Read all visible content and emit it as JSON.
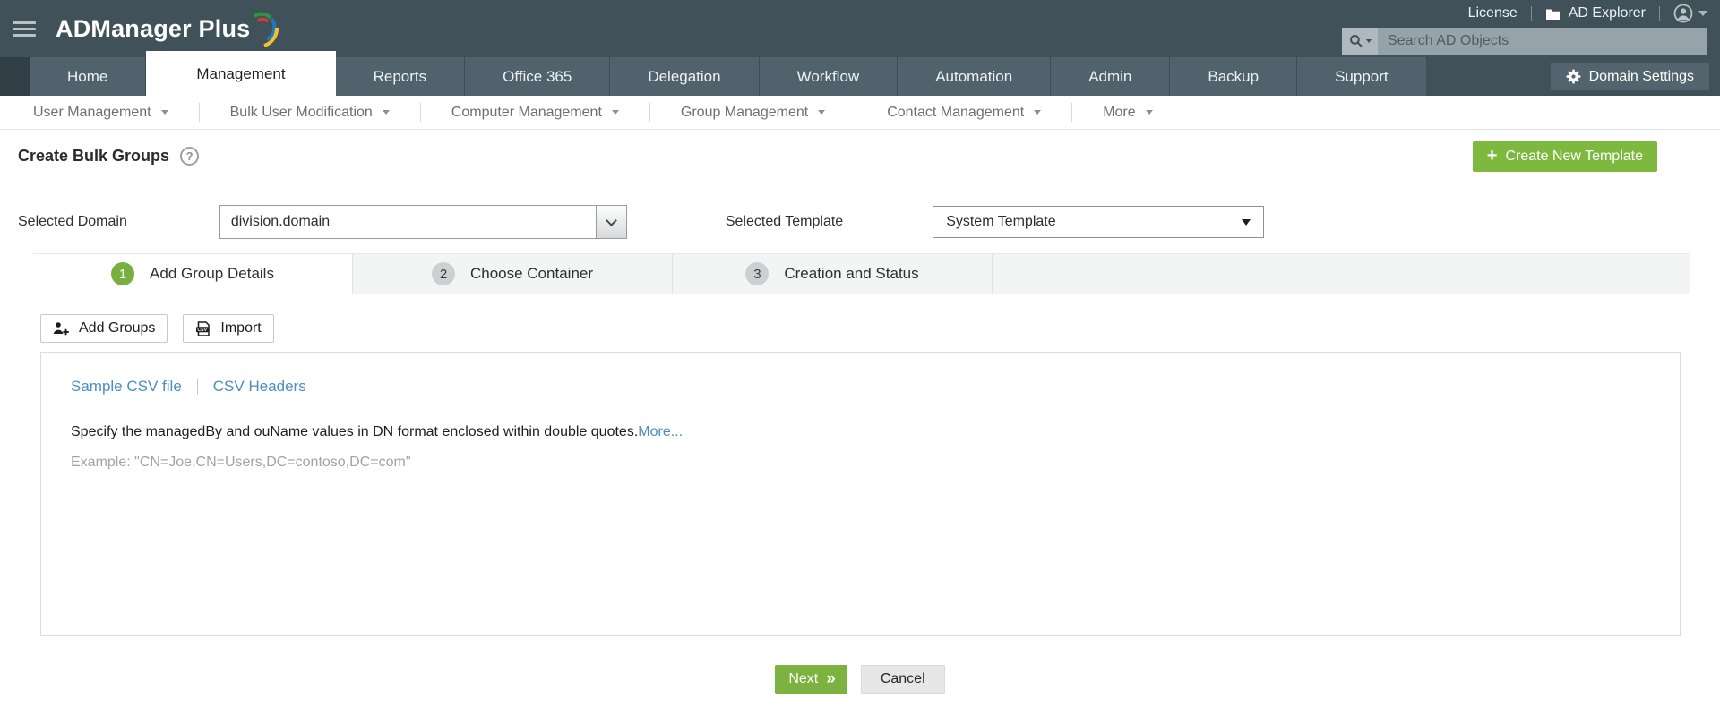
{
  "brand": {
    "logo_text": "ADManager Plus"
  },
  "topbar": {
    "license": "License",
    "ad_explorer": "AD Explorer",
    "search_placeholder": "Search AD Objects",
    "domain_settings": "Domain Settings"
  },
  "nav": {
    "tabs": [
      {
        "label": "Home"
      },
      {
        "label": "Management",
        "active": true
      },
      {
        "label": "Reports"
      },
      {
        "label": "Office 365"
      },
      {
        "label": "Delegation"
      },
      {
        "label": "Workflow"
      },
      {
        "label": "Automation"
      },
      {
        "label": "Admin"
      },
      {
        "label": "Backup"
      },
      {
        "label": "Support"
      }
    ]
  },
  "subnav": {
    "items": [
      {
        "label": "User Management"
      },
      {
        "label": "Bulk User Modification"
      },
      {
        "label": "Computer Management"
      },
      {
        "label": "Group Management"
      },
      {
        "label": "Contact Management"
      },
      {
        "label": "More"
      }
    ]
  },
  "page": {
    "title": "Create Bulk Groups",
    "help_glyph": "?",
    "create_template": "Create New Template",
    "plus_glyph": "+"
  },
  "form": {
    "domain_label": "Selected Domain",
    "domain_value": "division.domain",
    "template_label": "Selected Template",
    "template_value": "System Template"
  },
  "steps": [
    {
      "number": "1",
      "label": "Add Group Details",
      "active": true
    },
    {
      "number": "2",
      "label": "Choose Container"
    },
    {
      "number": "3",
      "label": "Creation and Status"
    }
  ],
  "toolbar": {
    "add_groups": "Add Groups",
    "import": "Import"
  },
  "content": {
    "sample_csv": "Sample CSV file",
    "csv_headers": "CSV Headers",
    "instruction": "Specify the managedBy and ouName values in DN format enclosed within double quotes.",
    "more": "More...",
    "example": "Example: \"CN=Joe,CN=Users,DC=contoso,DC=com\""
  },
  "actions": {
    "next": "Next",
    "next_chevrons": "»",
    "cancel": "Cancel"
  },
  "colors": {
    "header_dark": "#40515a",
    "tab_inactive": "#51626c",
    "accent_green": "#7cb23f",
    "link_blue": "#4a8fc0",
    "step_circle_gray": "#ccd0d2"
  }
}
